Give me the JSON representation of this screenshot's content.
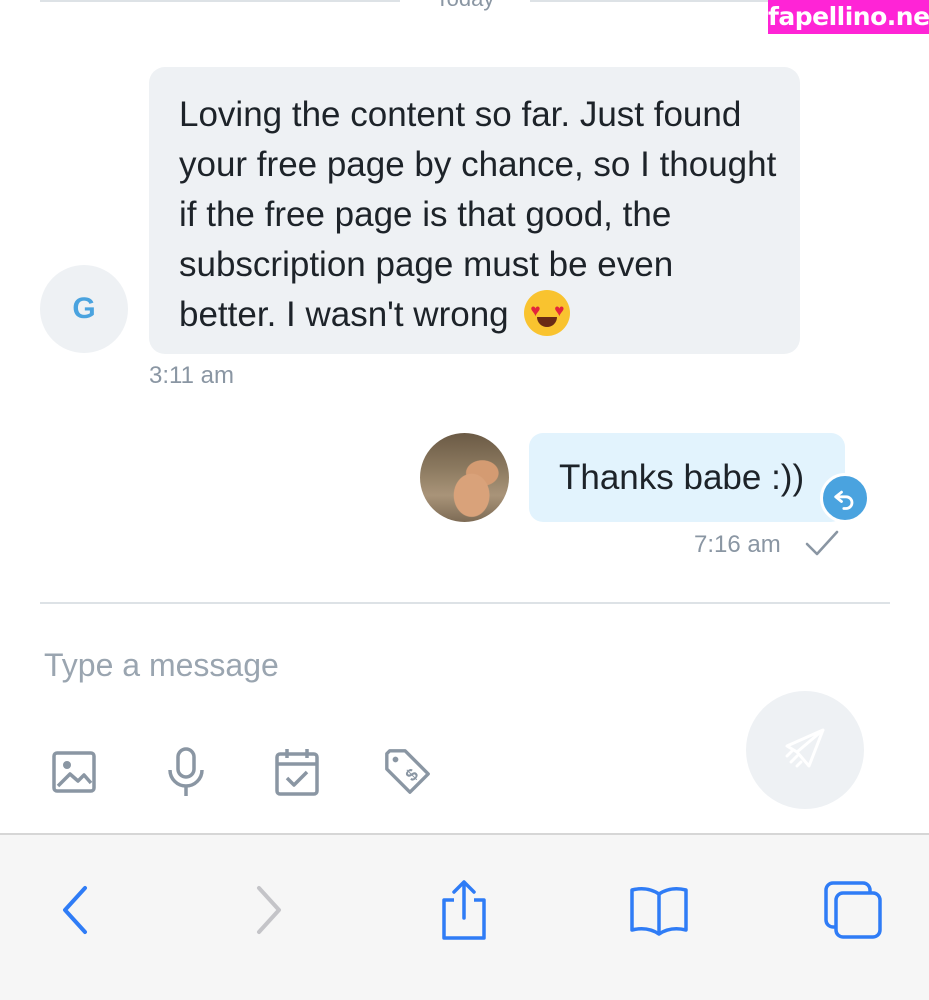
{
  "header": {
    "date_label": "Today",
    "watermark": "fapellino.net"
  },
  "messages": [
    {
      "direction": "incoming",
      "avatar_initial": "G",
      "text": "Loving the content so far. Just found your free page by chance, so I thought if the free page is that good, the subscription page must be even better. I wasn't wrong",
      "emoji": "heart-eyes-emoji",
      "time": "3:11 am"
    },
    {
      "direction": "outgoing",
      "text": "Thanks babe :))",
      "time": "7:16 am",
      "status": "sent"
    }
  ],
  "composer": {
    "placeholder": "Type a message",
    "tools": [
      "image-icon",
      "microphone-icon",
      "calendar-check-icon",
      "price-tag-icon"
    ],
    "send_icon": "send-icon"
  },
  "browser_toolbar": {
    "buttons": [
      "back-icon",
      "forward-icon",
      "share-icon",
      "bookmarks-icon",
      "tabs-icon"
    ]
  },
  "colors": {
    "accent": "#4aa3df",
    "incoming_bubble": "#eef1f4",
    "outgoing_bubble": "#e2f3fd",
    "muted_text": "#8a96a3",
    "safari_blue": "#2f7cf6",
    "watermark_bg": "#ff24d6"
  }
}
